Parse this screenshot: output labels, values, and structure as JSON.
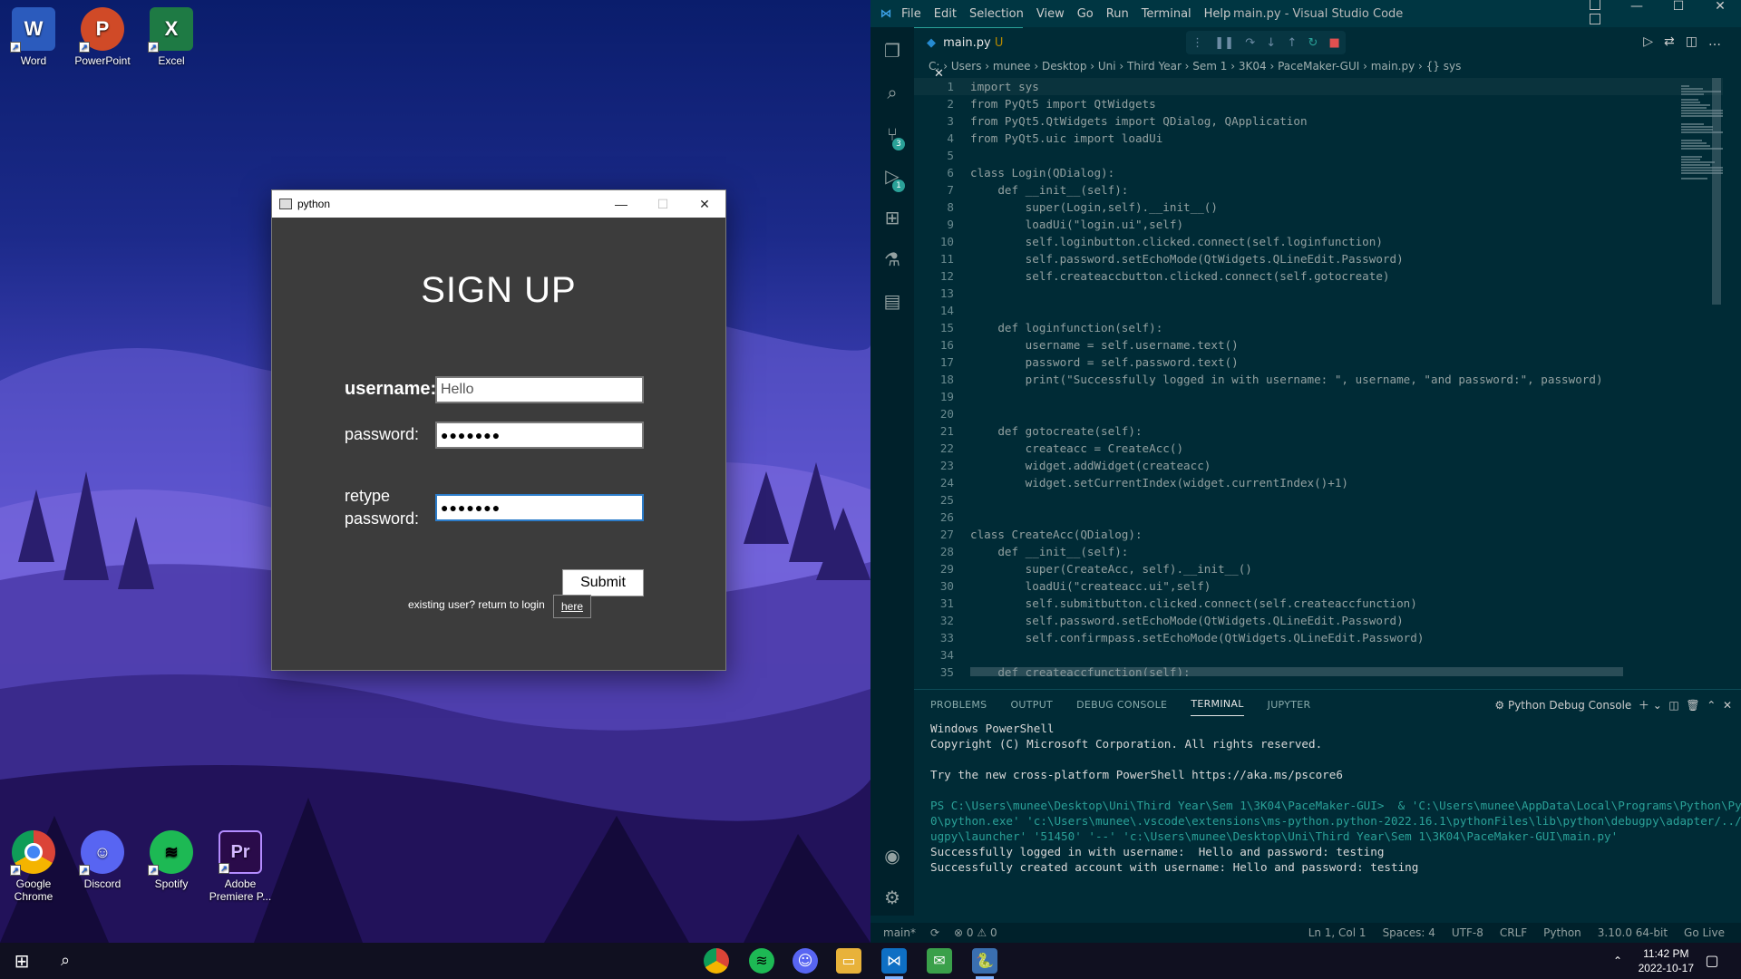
{
  "desktop": {
    "icons_top": [
      {
        "label": "Word",
        "letter": "W",
        "color": "#2b5bbd"
      },
      {
        "label": "PowerPoint",
        "letter": "P",
        "color": "#d04a27"
      },
      {
        "label": "Excel",
        "letter": "X",
        "color": "#1e7a44"
      }
    ],
    "icons_bottom": [
      {
        "label": "Google Chrome",
        "letter": "",
        "color": "#ffffff"
      },
      {
        "label": "Discord",
        "letter": "",
        "color": "#5865f2"
      },
      {
        "label": "Spotify",
        "letter": "",
        "color": "#1db954"
      },
      {
        "label": "Adobe Premiere P...",
        "letter": "Pr",
        "color": "#2a0b4a"
      }
    ]
  },
  "pywin": {
    "title": "python",
    "heading": "SIGN UP",
    "username_label": "username:",
    "username_value": "Hello",
    "password_label": "password:",
    "password_value": "●●●●●●●",
    "retype_label_1": "retype",
    "retype_label_2": "password:",
    "retype_value": "●●●●●●●",
    "submit_label": "Submit",
    "existing_text": "existing user? return to login",
    "here_label": "here"
  },
  "vscode": {
    "menu": [
      "File",
      "Edit",
      "Selection",
      "View",
      "Go",
      "Run",
      "Terminal",
      "Help"
    ],
    "window_title": "main.py - Visual Studio Code",
    "tab": {
      "name": "main.py",
      "modified": "U"
    },
    "breadcrumb": "C: › Users › munee › Desktop › Uni › Third Year › Sem 1 › 3K04 › PaceMaker-GUI › main.py › {} sys",
    "badges": {
      "scm": "3",
      "debug": "1"
    },
    "code": [
      "import sys",
      "from PyQt5 import QtWidgets",
      "from PyQt5.QtWidgets import QDialog, QApplication",
      "from PyQt5.uic import loadUi",
      "",
      "class Login(QDialog):",
      "    def __init__(self):",
      "        super(Login,self).__init__()",
      "        loadUi(\"login.ui\",self)",
      "        self.loginbutton.clicked.connect(self.loginfunction)",
      "        self.password.setEchoMode(QtWidgets.QLineEdit.Password)",
      "        self.createaccbutton.clicked.connect(self.gotocreate)",
      "",
      "",
      "    def loginfunction(self):",
      "        username = self.username.text()",
      "        password = self.password.text()",
      "        print(\"Successfully logged in with username: \", username, \"and password:\", password)",
      "",
      "",
      "    def gotocreate(self):",
      "        createacc = CreateAcc()",
      "        widget.addWidget(createacc)",
      "        widget.setCurrentIndex(widget.currentIndex()+1)",
      "",
      "",
      "class CreateAcc(QDialog):",
      "    def __init__(self):",
      "        super(CreateAcc, self).__init__()",
      "        loadUi(\"createacc.ui\",self)",
      "        self.submitbutton.clicked.connect(self.createaccfunction)",
      "        self.password.setEchoMode(QtWidgets.QLineEdit.Password)",
      "        self.confirmpass.setEchoMode(QtWidgets.QLineEdit.Password)",
      "",
      "    def createaccfunction(self):"
    ],
    "panel_tabs": [
      "PROBLEMS",
      "OUTPUT",
      "DEBUG CONSOLE",
      "TERMINAL",
      "JUPYTER"
    ],
    "panel_active": "TERMINAL",
    "panel_right": "Python Debug Console",
    "terminal": [
      "Windows PowerShell",
      "Copyright (C) Microsoft Corporation. All rights reserved.",
      "",
      "Try the new cross-platform PowerShell https://aka.ms/pscore6",
      "",
      "PS C:\\Users\\munee\\Desktop\\Uni\\Third Year\\Sem 1\\3K04\\PaceMaker-GUI>  & 'C:\\Users\\munee\\AppData\\Local\\Programs\\Python\\Python31",
      "0\\python.exe' 'c:\\Users\\munee\\.vscode\\extensions\\ms-python.python-2022.16.1\\pythonFiles\\lib\\python\\debugpy\\adapter/../..\\deb",
      "ugpy\\launcher' '51450' '--' 'c:\\Users\\munee\\Desktop\\Uni\\Third Year\\Sem 1\\3K04\\PaceMaker-GUI\\main.py'",
      "Successfully logged in with username:  Hello and password: testing",
      "Successfully created account with username: Hello and password: testing"
    ],
    "status_left": [
      "main*",
      "⟳",
      "⊗ 0 ⚠ 0"
    ],
    "status_right": [
      "Ln 1, Col 1",
      "Spaces: 4",
      "UTF-8",
      "CRLF",
      "Python",
      "3.10.0 64-bit",
      "Go Live"
    ]
  },
  "taskbar": {
    "time": "11:42 PM",
    "date": "2022-10-17"
  }
}
